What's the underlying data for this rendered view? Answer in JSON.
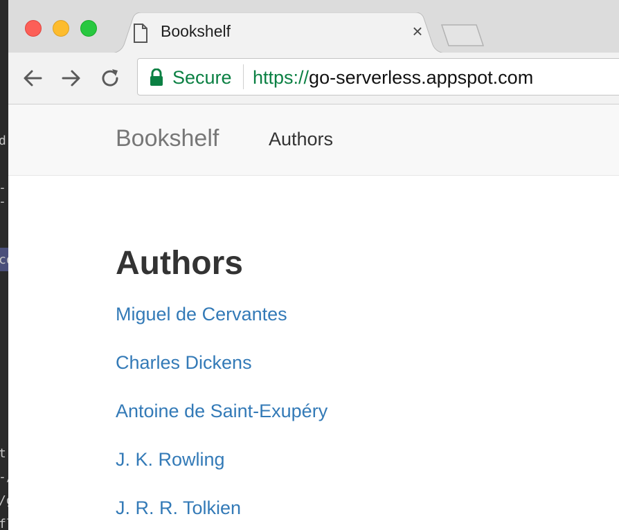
{
  "terminal": {
    "fragments": [
      "d(",
      "--",
      "co",
      "t",
      "-/",
      "/g",
      "fl"
    ]
  },
  "browser": {
    "tab": {
      "title": "Bookshelf",
      "close_glyph": "×",
      "icon": "document-icon"
    },
    "toolbar": {
      "back_icon": "back-arrow-icon",
      "forward_icon": "forward-arrow-icon",
      "reload_icon": "reload-icon"
    },
    "omnibox": {
      "security_label": "Secure",
      "url_scheme": "https://",
      "url_host": "go-serverless.appspot.com"
    }
  },
  "site": {
    "brand": "Bookshelf",
    "nav_links": [
      "Authors"
    ],
    "heading": "Authors",
    "authors": [
      "Miguel de Cervantes",
      "Charles Dickens",
      "Antoine de Saint-Exupéry",
      "J. K. Rowling",
      "J. R. R. Tolkien"
    ],
    "colors": {
      "link": "#337ab7",
      "secure_green": "#0b8043",
      "navbar_bg": "#f8f8f8"
    }
  }
}
